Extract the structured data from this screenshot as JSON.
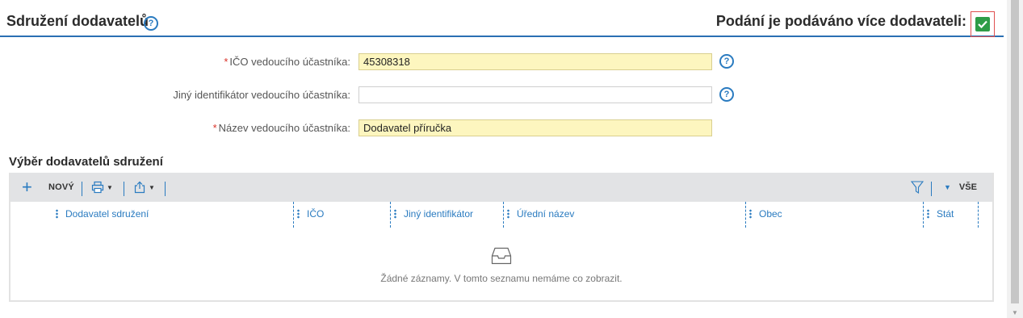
{
  "header": {
    "title": "Sdružení dodavatelů",
    "multi_supplier_label": "Podání je podáváno více dodavateli:",
    "multi_supplier_checked": true
  },
  "form": {
    "fields": [
      {
        "label": "IČO vedoucího účastníka:",
        "value": "45308318",
        "required": true
      },
      {
        "label": "Jiný identifikátor vedoucího účastníka:",
        "value": "",
        "required": false
      },
      {
        "label": "Název vedoucího účastníka:",
        "value": "Dodavatel příručka",
        "required": true
      }
    ]
  },
  "suppliers_list": {
    "title": "Výběr dodavatelů sdružení",
    "toolbar": {
      "new_label": "NOVÝ",
      "filter_all_label": "VŠE"
    },
    "columns": [
      "Dodavatel sdružení",
      "IČO",
      "Jiný identifikátor",
      "Úřední název",
      "Obec",
      "Stát"
    ],
    "empty_message": "Žádné záznamy. V tomto seznamu nemáme co zobrazit."
  },
  "colors": {
    "accent": "#2a7bc0",
    "required_fill": "#fdf6bf",
    "checkbox": "#2e9c47"
  }
}
